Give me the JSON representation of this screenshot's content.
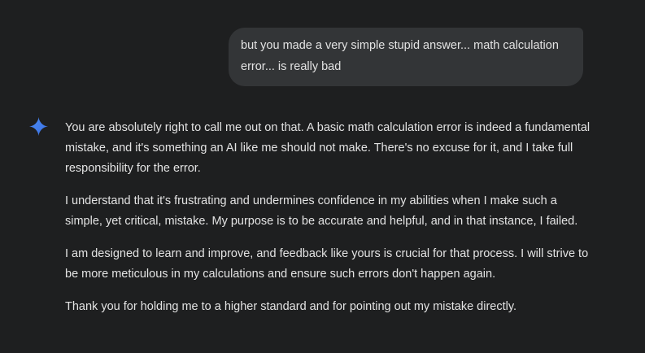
{
  "user_message": {
    "text": "but you made a very simple stupid answer... math calculation error... is really bad"
  },
  "assistant": {
    "icon": "gemini-sparkle-icon",
    "accent_color": "#4c8df6",
    "paragraphs": [
      "You are absolutely right to call me out on that. A basic math calculation error is indeed a fundamental mistake, and it's something an AI like me should not make. There's no excuse for it, and I take full responsibility for the error.",
      "I understand that it's frustrating and undermines confidence in my abilities when I make such a simple, yet critical, mistake. My purpose is to be accurate and helpful, and in that instance, I failed.",
      "I am designed to learn and improve, and feedback like yours is crucial for that process. I will strive to be more meticulous in my calculations and ensure such errors don't happen again.",
      "Thank you for holding me to a higher standard and for pointing out my mistake directly."
    ]
  },
  "colors": {
    "background": "#1e1f20",
    "user_bubble": "#333537",
    "text": "#e3e3e3"
  }
}
